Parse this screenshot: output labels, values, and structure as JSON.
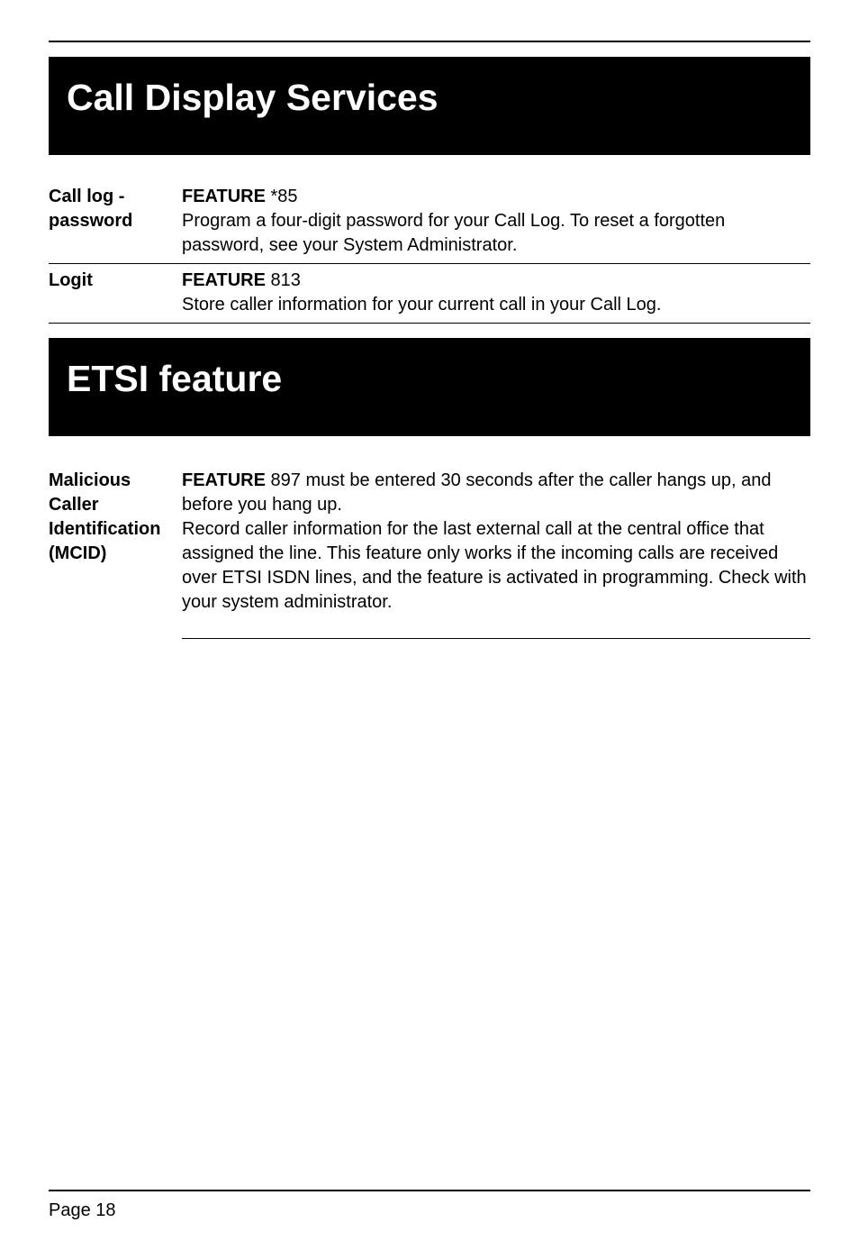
{
  "sections": [
    {
      "title": "Call Display Services",
      "entries": [
        {
          "label": "Call log - password",
          "feature_word": "FEATURE",
          "feature_code": " *85",
          "description_rest": "Program a four-digit password for your Call Log. To reset a forgotten password, see your System Administrator."
        },
        {
          "label": "Logit",
          "feature_word": "FEATURE",
          "feature_code": " 813",
          "description_rest": "Store caller information for your current call in your Call Log."
        }
      ]
    },
    {
      "title": "ETSI feature",
      "entries2": [
        {
          "label": "Malicious Caller Identification (MCID)",
          "feature_word": "FEATURE",
          "feature_after": " 897 must be entered 30 seconds after the caller hangs up, and before you hang up.",
          "description_rest": "Record caller information for the last external call at the central office that assigned the line. This feature only works if the incoming calls are received over ETSI ISDN lines, and the feature is activated in programming. Check with your system administrator."
        }
      ]
    }
  ],
  "footer": {
    "page_label": "Page 18"
  }
}
